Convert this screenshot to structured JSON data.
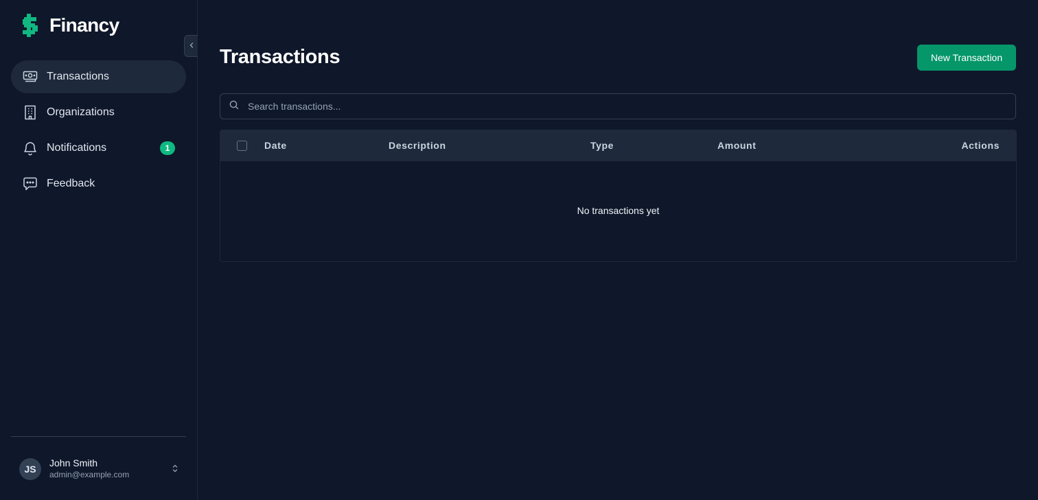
{
  "brand": {
    "name": "Financy",
    "icon": "dollar-icon",
    "accent": "#10b981"
  },
  "sidebar": {
    "items": [
      {
        "label": "Transactions",
        "icon": "banknote-icon",
        "active": true
      },
      {
        "label": "Organizations",
        "icon": "building-icon"
      },
      {
        "label": "Notifications",
        "icon": "bell-icon",
        "badge": "1"
      },
      {
        "label": "Feedback",
        "icon": "message-icon"
      }
    ],
    "collapse_icon": "chevron-left-icon"
  },
  "user": {
    "initials": "JS",
    "name": "John Smith",
    "email": "admin@example.com",
    "chevron_icon": "chevrons-up-down-icon"
  },
  "main": {
    "title": "Transactions",
    "new_button": "New Transaction",
    "search": {
      "placeholder": "Search transactions...",
      "value": "",
      "icon": "search-icon"
    },
    "table": {
      "columns": [
        "Date",
        "Description",
        "Type",
        "Amount",
        "Actions"
      ],
      "rows": [],
      "empty_message": "No transactions yet"
    }
  },
  "colors": {
    "background": "#0f172a",
    "panel": "#1e293b",
    "primary_button": "#059669",
    "badge": "#10b981"
  }
}
